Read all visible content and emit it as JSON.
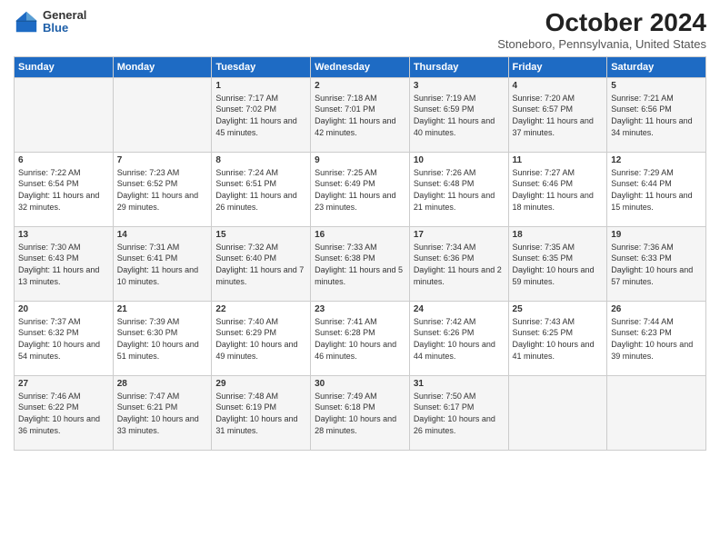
{
  "logo": {
    "general": "General",
    "blue": "Blue"
  },
  "title": "October 2024",
  "location": "Stoneboro, Pennsylvania, United States",
  "days_of_week": [
    "Sunday",
    "Monday",
    "Tuesday",
    "Wednesday",
    "Thursday",
    "Friday",
    "Saturday"
  ],
  "weeks": [
    [
      {
        "day": "",
        "sunrise": "",
        "sunset": "",
        "daylight": ""
      },
      {
        "day": "",
        "sunrise": "",
        "sunset": "",
        "daylight": ""
      },
      {
        "day": "1",
        "sunrise": "Sunrise: 7:17 AM",
        "sunset": "Sunset: 7:02 PM",
        "daylight": "Daylight: 11 hours and 45 minutes."
      },
      {
        "day": "2",
        "sunrise": "Sunrise: 7:18 AM",
        "sunset": "Sunset: 7:01 PM",
        "daylight": "Daylight: 11 hours and 42 minutes."
      },
      {
        "day": "3",
        "sunrise": "Sunrise: 7:19 AM",
        "sunset": "Sunset: 6:59 PM",
        "daylight": "Daylight: 11 hours and 40 minutes."
      },
      {
        "day": "4",
        "sunrise": "Sunrise: 7:20 AM",
        "sunset": "Sunset: 6:57 PM",
        "daylight": "Daylight: 11 hours and 37 minutes."
      },
      {
        "day": "5",
        "sunrise": "Sunrise: 7:21 AM",
        "sunset": "Sunset: 6:56 PM",
        "daylight": "Daylight: 11 hours and 34 minutes."
      }
    ],
    [
      {
        "day": "6",
        "sunrise": "Sunrise: 7:22 AM",
        "sunset": "Sunset: 6:54 PM",
        "daylight": "Daylight: 11 hours and 32 minutes."
      },
      {
        "day": "7",
        "sunrise": "Sunrise: 7:23 AM",
        "sunset": "Sunset: 6:52 PM",
        "daylight": "Daylight: 11 hours and 29 minutes."
      },
      {
        "day": "8",
        "sunrise": "Sunrise: 7:24 AM",
        "sunset": "Sunset: 6:51 PM",
        "daylight": "Daylight: 11 hours and 26 minutes."
      },
      {
        "day": "9",
        "sunrise": "Sunrise: 7:25 AM",
        "sunset": "Sunset: 6:49 PM",
        "daylight": "Daylight: 11 hours and 23 minutes."
      },
      {
        "day": "10",
        "sunrise": "Sunrise: 7:26 AM",
        "sunset": "Sunset: 6:48 PM",
        "daylight": "Daylight: 11 hours and 21 minutes."
      },
      {
        "day": "11",
        "sunrise": "Sunrise: 7:27 AM",
        "sunset": "Sunset: 6:46 PM",
        "daylight": "Daylight: 11 hours and 18 minutes."
      },
      {
        "day": "12",
        "sunrise": "Sunrise: 7:29 AM",
        "sunset": "Sunset: 6:44 PM",
        "daylight": "Daylight: 11 hours and 15 minutes."
      }
    ],
    [
      {
        "day": "13",
        "sunrise": "Sunrise: 7:30 AM",
        "sunset": "Sunset: 6:43 PM",
        "daylight": "Daylight: 11 hours and 13 minutes."
      },
      {
        "day": "14",
        "sunrise": "Sunrise: 7:31 AM",
        "sunset": "Sunset: 6:41 PM",
        "daylight": "Daylight: 11 hours and 10 minutes."
      },
      {
        "day": "15",
        "sunrise": "Sunrise: 7:32 AM",
        "sunset": "Sunset: 6:40 PM",
        "daylight": "Daylight: 11 hours and 7 minutes."
      },
      {
        "day": "16",
        "sunrise": "Sunrise: 7:33 AM",
        "sunset": "Sunset: 6:38 PM",
        "daylight": "Daylight: 11 hours and 5 minutes."
      },
      {
        "day": "17",
        "sunrise": "Sunrise: 7:34 AM",
        "sunset": "Sunset: 6:36 PM",
        "daylight": "Daylight: 11 hours and 2 minutes."
      },
      {
        "day": "18",
        "sunrise": "Sunrise: 7:35 AM",
        "sunset": "Sunset: 6:35 PM",
        "daylight": "Daylight: 10 hours and 59 minutes."
      },
      {
        "day": "19",
        "sunrise": "Sunrise: 7:36 AM",
        "sunset": "Sunset: 6:33 PM",
        "daylight": "Daylight: 10 hours and 57 minutes."
      }
    ],
    [
      {
        "day": "20",
        "sunrise": "Sunrise: 7:37 AM",
        "sunset": "Sunset: 6:32 PM",
        "daylight": "Daylight: 10 hours and 54 minutes."
      },
      {
        "day": "21",
        "sunrise": "Sunrise: 7:39 AM",
        "sunset": "Sunset: 6:30 PM",
        "daylight": "Daylight: 10 hours and 51 minutes."
      },
      {
        "day": "22",
        "sunrise": "Sunrise: 7:40 AM",
        "sunset": "Sunset: 6:29 PM",
        "daylight": "Daylight: 10 hours and 49 minutes."
      },
      {
        "day": "23",
        "sunrise": "Sunrise: 7:41 AM",
        "sunset": "Sunset: 6:28 PM",
        "daylight": "Daylight: 10 hours and 46 minutes."
      },
      {
        "day": "24",
        "sunrise": "Sunrise: 7:42 AM",
        "sunset": "Sunset: 6:26 PM",
        "daylight": "Daylight: 10 hours and 44 minutes."
      },
      {
        "day": "25",
        "sunrise": "Sunrise: 7:43 AM",
        "sunset": "Sunset: 6:25 PM",
        "daylight": "Daylight: 10 hours and 41 minutes."
      },
      {
        "day": "26",
        "sunrise": "Sunrise: 7:44 AM",
        "sunset": "Sunset: 6:23 PM",
        "daylight": "Daylight: 10 hours and 39 minutes."
      }
    ],
    [
      {
        "day": "27",
        "sunrise": "Sunrise: 7:46 AM",
        "sunset": "Sunset: 6:22 PM",
        "daylight": "Daylight: 10 hours and 36 minutes."
      },
      {
        "day": "28",
        "sunrise": "Sunrise: 7:47 AM",
        "sunset": "Sunset: 6:21 PM",
        "daylight": "Daylight: 10 hours and 33 minutes."
      },
      {
        "day": "29",
        "sunrise": "Sunrise: 7:48 AM",
        "sunset": "Sunset: 6:19 PM",
        "daylight": "Daylight: 10 hours and 31 minutes."
      },
      {
        "day": "30",
        "sunrise": "Sunrise: 7:49 AM",
        "sunset": "Sunset: 6:18 PM",
        "daylight": "Daylight: 10 hours and 28 minutes."
      },
      {
        "day": "31",
        "sunrise": "Sunrise: 7:50 AM",
        "sunset": "Sunset: 6:17 PM",
        "daylight": "Daylight: 10 hours and 26 minutes."
      },
      {
        "day": "",
        "sunrise": "",
        "sunset": "",
        "daylight": ""
      },
      {
        "day": "",
        "sunrise": "",
        "sunset": "",
        "daylight": ""
      }
    ]
  ]
}
